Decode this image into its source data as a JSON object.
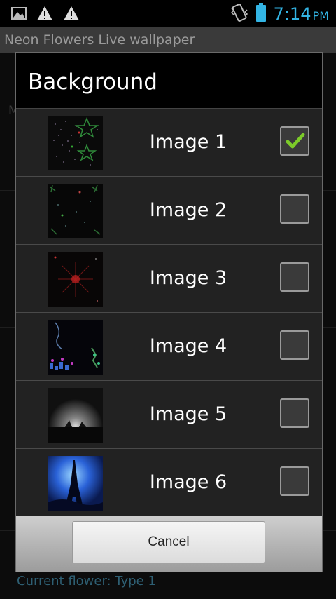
{
  "status_bar": {
    "time": "7:14",
    "ampm": "PM",
    "icons": [
      "image-icon",
      "warning-icon",
      "warning-icon",
      "vibrate-icon",
      "battery-icon"
    ]
  },
  "app": {
    "title": "Neon Flowers Live wallpaper",
    "partial_label": "M",
    "bottom_text": "Current flower: Type 1"
  },
  "dialog": {
    "title": "Background",
    "items": [
      {
        "label": "Image 1",
        "checked": true
      },
      {
        "label": "Image 2",
        "checked": false
      },
      {
        "label": "Image 3",
        "checked": false
      },
      {
        "label": "Image 4",
        "checked": false
      },
      {
        "label": "Image 5",
        "checked": false
      },
      {
        "label": "Image 6",
        "checked": false
      }
    ],
    "cancel_label": "Cancel"
  },
  "colors": {
    "accent": "#33b5e5",
    "check": "#7ccb29"
  }
}
